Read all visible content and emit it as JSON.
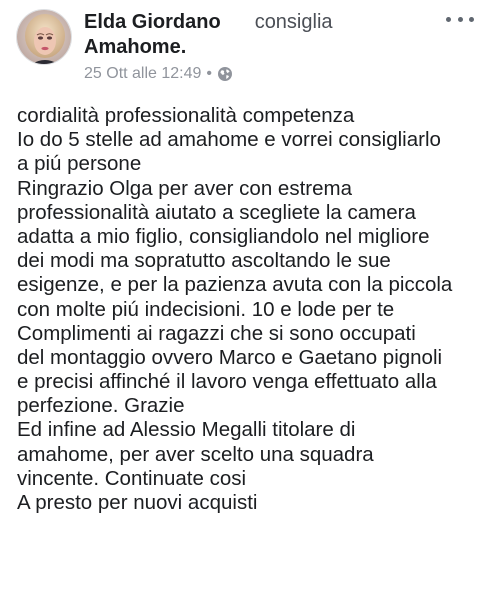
{
  "post": {
    "author": "Elda Giordano",
    "action": "consiglia",
    "page": "Amahome.",
    "timestamp": "25 Ott alle 12:49",
    "separator": "•",
    "privacy_icon": "globe-icon",
    "more_icon": "more-options-icon",
    "lines": [
      "cordialità professionalità competenza",
      "Io do 5 stelle ad amahome e vorrei consigliarlo",
      "a piú persone",
      "Ringrazio Olga per aver con estrema",
      "professionalità aiutato a scegliete la camera",
      "adatta a mio figlio, consigliandolo nel migliore",
      "dei modi ma sopratutto ascoltando le sue",
      "esigenze, e per la pazienza avuta con la piccola",
      "con molte piú indecisioni. 10 e lode per te",
      "Complimenti ai ragazzi che si sono occupati",
      "del montaggio ovvero Marco e Gaetano pignoli",
      "e precisi affinché il lavoro venga effettuato alla",
      "perfezione. Grazie",
      "Ed infine ad Alessio Megalli titolare di",
      "amahome, per aver scelto una squadra",
      "vincente. Continuate cosi",
      "A presto per nuovi acquisti"
    ]
  }
}
